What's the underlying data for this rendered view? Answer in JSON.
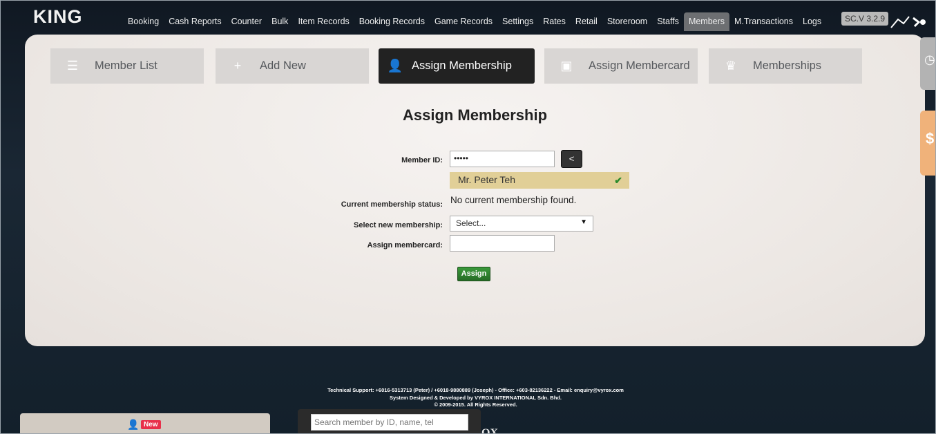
{
  "app": {
    "logo": "KING",
    "version": "SC.V 3.2.9"
  },
  "nav": [
    "Booking",
    "Cash Reports",
    "Counter",
    "Bulk",
    "Item Records",
    "Booking Records",
    "Game Records",
    "Settings",
    "Rates",
    "Retail",
    "Storeroom",
    "Staffs",
    "Members",
    "M.Transactions",
    "Logs"
  ],
  "nav_active": "Members",
  "tabs": {
    "member_list": "Member List",
    "add_new": "Add New",
    "assign_membership": "Assign Membership",
    "assign_membercard": "Assign Membercard",
    "memberships": "Memberships"
  },
  "form": {
    "title": "Assign Membership",
    "member_id_label": "Member ID:",
    "member_id_value": "•••••",
    "back_label": "<",
    "member_found": "Mr. Peter Teh",
    "status_label": "Current membership status:",
    "status_value": "No current membership found.",
    "select_label": "Select new membership:",
    "select_value": "Select...",
    "membercard_label": "Assign membercard:",
    "membercard_value": "",
    "assign_button": "Assign"
  },
  "footer": {
    "line1": "Technical Support: +6016-5313713 (Peter) / +6018-9880889 (Joseph) - Office: +603-82136222 - Email: enquiry@vyrox.com",
    "line2": "System Designed & Developed by VYROX INTERNATIONAL Sdn. Bhd.",
    "line3": "© 2009-2015. All Rights Reserved."
  },
  "bottom": {
    "new_badge": "New",
    "search_placeholder": "Search member by ID, name, tel",
    "logo_fragment": "OX"
  },
  "colors": {
    "active_tab": "#222222",
    "member_found_bg": "#e1cf97",
    "assign_button": "#2f7d2f",
    "side_money": "#f0b27a",
    "new_badge": "#e8304a"
  }
}
